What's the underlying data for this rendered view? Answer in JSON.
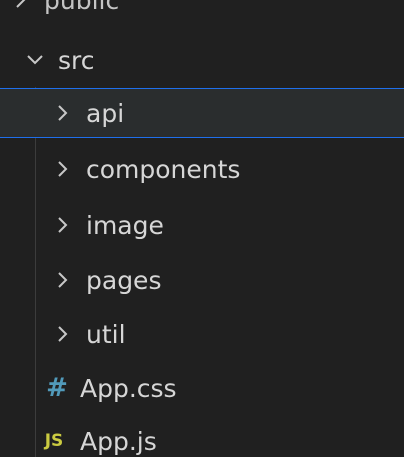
{
  "tree": {
    "public": {
      "label": "public",
      "expanded": false
    },
    "src": {
      "label": "src",
      "expanded": true
    },
    "folders": [
      {
        "label": "api",
        "selected": true
      },
      {
        "label": "components"
      },
      {
        "label": "image"
      },
      {
        "label": "pages"
      },
      {
        "label": "util"
      }
    ],
    "files": [
      {
        "label": "App.css",
        "icon": "css-hash-icon",
        "icon_text": "#",
        "icon_color": "#519aba"
      },
      {
        "label": "App.js",
        "icon": "js-icon",
        "icon_text": "JS",
        "icon_color": "#cbcb41"
      }
    ]
  },
  "colors": {
    "background": "#202020",
    "selection_border": "#1f6feb",
    "selection_fill": "#2a2d2e",
    "text": "#d6d6d6"
  }
}
